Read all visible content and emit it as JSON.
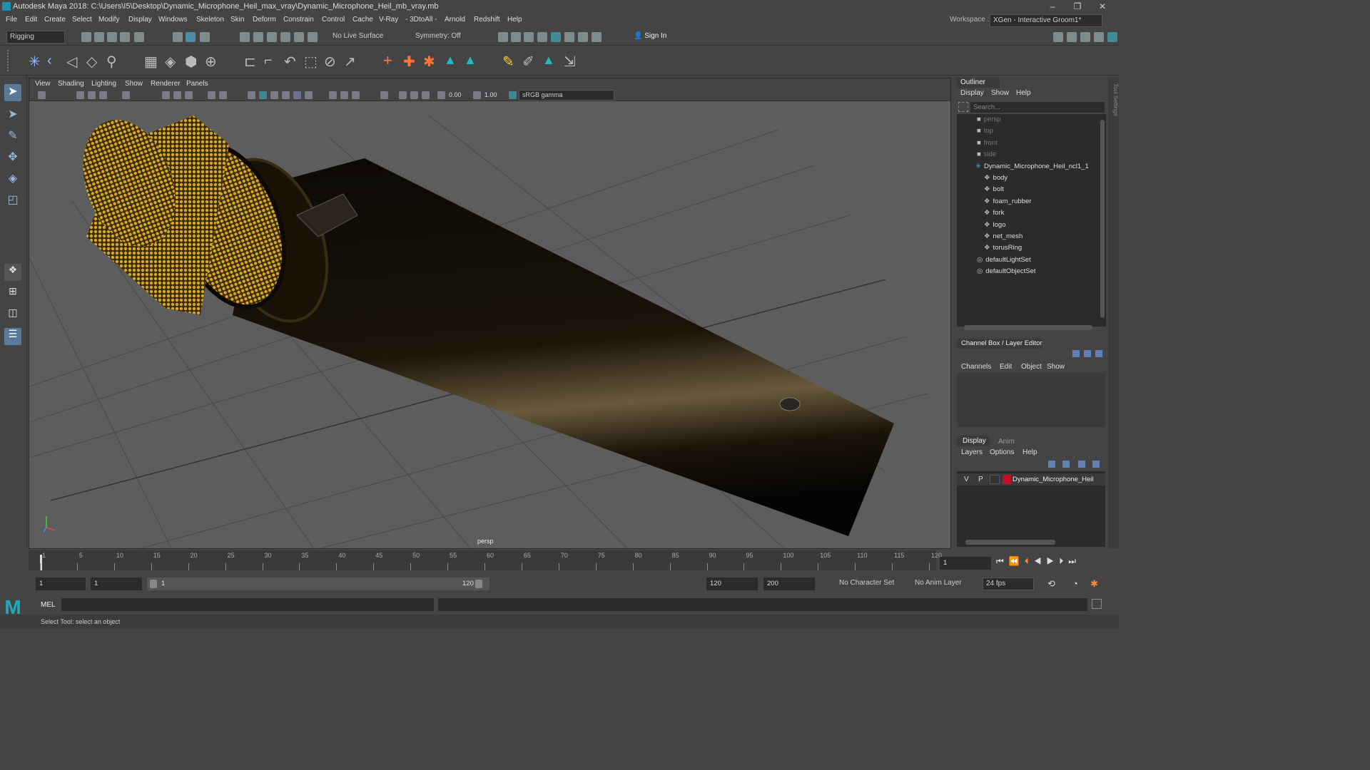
{
  "title": "Autodesk Maya 2018: C:\\Users\\I5\\Desktop\\Dynamic_Microphone_Heil_max_vray\\Dynamic_Microphone_Heil_mb_vray.mb",
  "menus": [
    "File",
    "Edit",
    "Create",
    "Select",
    "Modify",
    "Display",
    "Windows",
    "Skeleton",
    "Skin",
    "Deform",
    "Constrain",
    "Control",
    "Cache",
    "V-Ray",
    "- 3DtoAll -",
    "Arnold",
    "Redshift",
    "Help"
  ],
  "workspace_label": "Workspace :",
  "workspace_value": "XGen - Interactive Groom1*",
  "mode": "Rigging",
  "live_surface": "No Live Surface",
  "symmetry": "Symmetry: Off",
  "sign_in": "Sign In",
  "viewport": {
    "menus": [
      "View",
      "Shading",
      "Lighting",
      "Show",
      "Renderer",
      "Panels"
    ],
    "exposure": "0.00",
    "gamma": "1.00",
    "color_space": "sRGB gamma",
    "camera_label": "persp"
  },
  "outliner": {
    "title": "Outliner",
    "menus": [
      "Display",
      "Show",
      "Help"
    ],
    "search_placeholder": "Search...",
    "items": [
      {
        "label": "persp",
        "dim": true,
        "indent": 1
      },
      {
        "label": "top",
        "dim": true,
        "indent": 1
      },
      {
        "label": "front",
        "dim": true,
        "indent": 1
      },
      {
        "label": "side",
        "dim": true,
        "indent": 1
      },
      {
        "label": "Dynamic_Microphone_Heil_ncl1_1",
        "dim": false,
        "indent": 0
      },
      {
        "label": "body",
        "dim": false,
        "indent": 2
      },
      {
        "label": "bolt",
        "dim": false,
        "indent": 2
      },
      {
        "label": "foam_rubber",
        "dim": false,
        "indent": 2
      },
      {
        "label": "fork",
        "dim": false,
        "indent": 2
      },
      {
        "label": "logo",
        "dim": false,
        "indent": 2
      },
      {
        "label": "net_mesh",
        "dim": false,
        "indent": 2
      },
      {
        "label": "torusRing",
        "dim": false,
        "indent": 2
      },
      {
        "label": "defaultLightSet",
        "dim": false,
        "indent": 1
      },
      {
        "label": "defaultObjectSet",
        "dim": false,
        "indent": 1
      }
    ]
  },
  "channel_box": {
    "title": "Channel Box / Layer Editor",
    "menus": [
      "Channels",
      "Edit",
      "Object",
      "Show"
    ]
  },
  "layers": {
    "tabs": [
      "Display",
      "Anim"
    ],
    "menus": [
      "Layers",
      "Options",
      "Help"
    ],
    "row": {
      "v": "V",
      "p": "P",
      "name": "Dynamic_Microphone_Heil",
      "color": "#c0102a"
    }
  },
  "timeline": {
    "ticks": [
      "1",
      "5",
      "10",
      "15",
      "20",
      "25",
      "30",
      "35",
      "40",
      "45",
      "50",
      "55",
      "60",
      "65",
      "70",
      "75",
      "80",
      "85",
      "90",
      "95",
      "100",
      "105",
      "110",
      "115",
      "120"
    ],
    "current_frame": "1"
  },
  "range": {
    "start": "1",
    "start2": "1",
    "slider_start": "1",
    "slider_end": "120",
    "end": "120",
    "end2": "200",
    "character_set": "No Character Set",
    "anim_layer": "No Anim Layer",
    "fps": "24 fps"
  },
  "cmd_label": "MEL",
  "help_line": "Select Tool: select an object"
}
